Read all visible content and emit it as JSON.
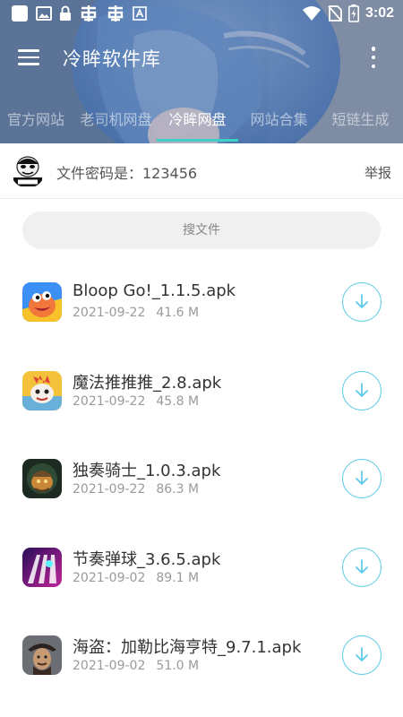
{
  "statusbar": {
    "time": "3:02",
    "icons": [
      "square-icon",
      "image-icon",
      "lock-icon",
      "app-icon",
      "app-icon",
      "font-icon",
      "wifi-icon",
      "no-sim-icon",
      "battery-charging-icon"
    ]
  },
  "toolbar": {
    "title": "冷眸软件库",
    "menu_icon": "hamburger-menu-icon",
    "more_icon": "more-vertical-icon"
  },
  "tabs": [
    {
      "label": "官方网站",
      "active": false
    },
    {
      "label": "老司机网盘",
      "active": false
    },
    {
      "label": "冷眸网盘",
      "active": true
    },
    {
      "label": "网站合集",
      "active": false
    },
    {
      "label": "短链生成",
      "active": false
    }
  ],
  "password_row": {
    "text": "文件密码是：123456",
    "report": "举报"
  },
  "search": {
    "placeholder": "搜文件"
  },
  "files": [
    {
      "name": "Bloop Go!_1.1.5.apk",
      "date": "2021-09-22",
      "size": "41.6 M"
    },
    {
      "name": "魔法推推推_2.8.apk",
      "date": "2021-09-22",
      "size": "45.8 M"
    },
    {
      "name": "独奏骑士_1.0.3.apk",
      "date": "2021-09-22",
      "size": "86.3 M"
    },
    {
      "name": "节奏弹球_3.6.5.apk",
      "date": "2021-09-02",
      "size": "89.1 M"
    },
    {
      "name": "海盗：加勒比海亨特_9.7.1.apk",
      "date": "2021-09-02",
      "size": "51.0 M"
    }
  ],
  "colors": {
    "accent": "#3fcfc4",
    "download": "#5ac8e8",
    "text_primary": "#333333",
    "text_secondary": "#9a9a9a"
  }
}
